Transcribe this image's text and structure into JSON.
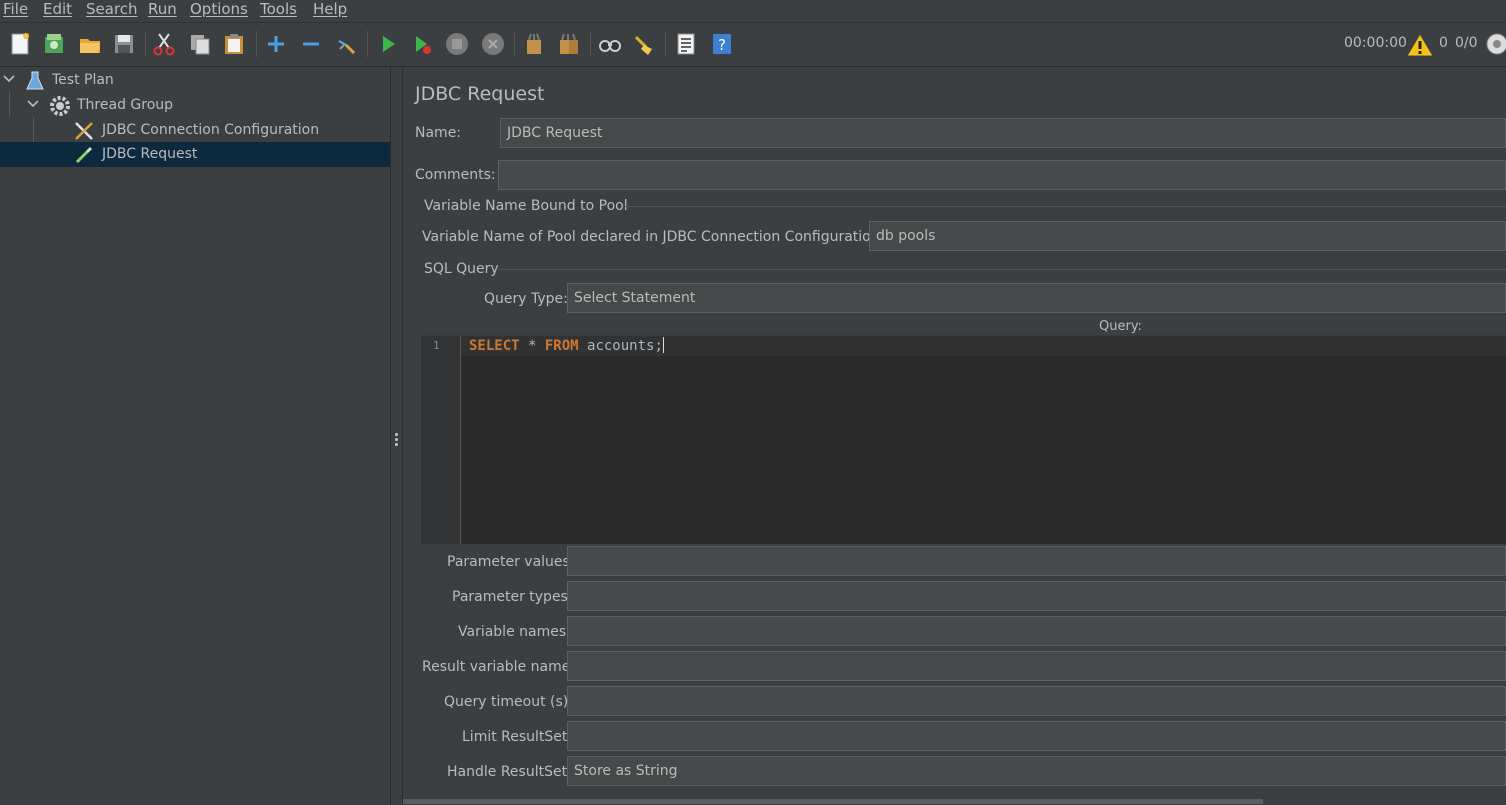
{
  "menu": [
    "File",
    "Edit",
    "Search",
    "Run",
    "Options",
    "Tools",
    "Help"
  ],
  "toolbar": {
    "icons": [
      "new-icon",
      "templates-icon",
      "open-icon",
      "save-icon",
      "cut-icon",
      "copy-icon",
      "paste-icon",
      "expand-icon",
      "collapse-icon",
      "toggle-icon",
      "start-icon",
      "start-no-pause-icon",
      "stop-icon",
      "shutdown-icon",
      "clear-icon",
      "clear-all-icon",
      "search-icon",
      "reset-search-icon",
      "function-helper-icon",
      "help-icon"
    ],
    "timer": "00:00:00",
    "warnings": "0",
    "threads": "0/0"
  },
  "tree": {
    "items": [
      {
        "label": "Test Plan",
        "icon": "flask-icon"
      },
      {
        "label": "Thread Group",
        "icon": "gear-icon"
      },
      {
        "label": "JDBC Connection Configuration",
        "icon": "tools-icon"
      },
      {
        "label": "JDBC Request",
        "icon": "pipette-icon"
      }
    ]
  },
  "panel": {
    "title": "JDBC Request",
    "name_label": "Name:",
    "name_value": "JDBC Request",
    "comments_label": "Comments:",
    "comments_value": "",
    "pool_group_title": "Variable Name Bound to Pool",
    "pool_label": "Variable Name of Pool declared in JDBC Connection Configuration:",
    "pool_value": "db pools",
    "sql_group_title": "SQL Query",
    "query_type_label": "Query Type:",
    "query_type_value": "Select Statement",
    "query_label": "Query:",
    "line_number": "1",
    "query_kw1": "SELECT",
    "query_star": " * ",
    "query_kw2": "FROM",
    "query_rest": " accounts;",
    "param_values_label": "Parameter values:",
    "param_values": "",
    "param_types_label": "Parameter types:",
    "param_types": "",
    "var_names_label": "Variable names:",
    "var_names": "",
    "result_var_label": "Result variable name:",
    "result_var": "",
    "timeout_label": "Query timeout (s):",
    "timeout": "",
    "limit_label": "Limit ResultSet:",
    "limit": "",
    "handle_label": "Handle ResultSet:",
    "handle_value": "Store as String"
  }
}
